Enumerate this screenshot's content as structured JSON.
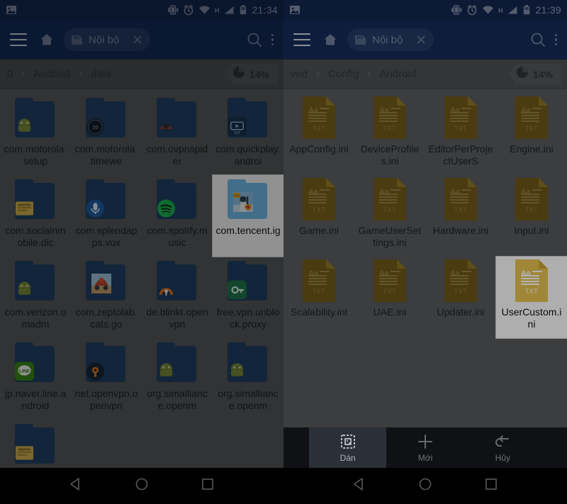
{
  "panes": [
    {
      "id": "left",
      "statusbar": {
        "icons": [
          "image-icon",
          "vibrate-icon",
          "alarm-icon",
          "wifi-icon",
          "signal-icon",
          "battery-icon"
        ],
        "network_type": "H",
        "time": "21:34"
      },
      "toolbar": {
        "menu_icon": "hamburger-icon",
        "home_icon": "home-icon",
        "tab_icon": "sdcard-icon",
        "tab_label": "Nội bộ",
        "tab_close_icon": "close-icon",
        "search_icon": "search-icon",
        "overflow_icon": "overflow-menu-icon"
      },
      "breadcrumb": {
        "crumbs": [
          "0",
          "Android",
          "data"
        ],
        "separator": "›",
        "storage_icon": "pie-chart-icon",
        "storage_percent": "14%"
      },
      "items": [
        {
          "name": "com.motorola.setup",
          "type": "folder",
          "badge": "android-robot-icon",
          "selected": false
        },
        {
          "name": "com.motorola.timewe",
          "type": "folder",
          "badge": "watch-face-icon",
          "selected": false
        },
        {
          "name": "com.ovpnspider",
          "type": "folder",
          "badge": "ovpn-spider-icon",
          "selected": false
        },
        {
          "name": "com.quickplay.androi",
          "type": "folder",
          "badge": "video-player-icon",
          "selected": false
        },
        {
          "name": "com.socialnmobile.dic",
          "type": "folder",
          "badge": "notepad-icon",
          "selected": false
        },
        {
          "name": "com.splendapps.vox",
          "type": "folder",
          "badge": "microphone-icon",
          "selected": false
        },
        {
          "name": "com.spotify.music",
          "type": "folder",
          "badge": "spotify-icon",
          "selected": false
        },
        {
          "name": "com.tencent.ig",
          "type": "folder",
          "badge": "pubg-mobile-icon",
          "selected": true
        },
        {
          "name": "com.verizon.omadm",
          "type": "folder",
          "badge": "android-robot-icon",
          "selected": false
        },
        {
          "name": "com.zeptolab.cats.go",
          "type": "folder",
          "badge": "cats-game-icon",
          "selected": false
        },
        {
          "name": "de.blinkt.openvpn",
          "type": "folder",
          "badge": "openvpn-icon",
          "selected": false
        },
        {
          "name": "free.vpn.unblock.proxy",
          "type": "folder",
          "badge": "vpn-key-icon",
          "selected": false
        },
        {
          "name": "jp.naver.line.android",
          "type": "folder",
          "badge": "line-icon",
          "selected": false
        },
        {
          "name": "net.openvpn.openvpn",
          "type": "folder",
          "badge": "openvpn-connect-icon",
          "selected": false
        },
        {
          "name": "org.simalliance.openm",
          "type": "folder",
          "badge": "android-robot-icon",
          "selected": false
        },
        {
          "name": "org.simalliance.openm",
          "type": "folder",
          "badge": "android-robot-icon",
          "selected": false
        },
        {
          "name": "",
          "type": "folder",
          "badge": "notepad-icon",
          "selected": false
        }
      ],
      "actionbar": null
    },
    {
      "id": "right",
      "statusbar": {
        "icons": [
          "image-icon",
          "vibrate-icon",
          "alarm-icon",
          "wifi-icon",
          "signal-icon",
          "battery-icon"
        ],
        "network_type": "H",
        "time": "21:39"
      },
      "toolbar": {
        "menu_icon": "hamburger-icon",
        "home_icon": "home-icon",
        "tab_icon": "sdcard-icon",
        "tab_label": "Nội bộ",
        "tab_close_icon": "close-icon",
        "search_icon": "search-icon",
        "overflow_icon": "overflow-menu-icon"
      },
      "breadcrumb": {
        "crumbs": [
          "ved",
          "Config",
          "Android"
        ],
        "separator": "›",
        "storage_icon": "pie-chart-icon",
        "storage_percent": "14%"
      },
      "items": [
        {
          "name": "AppConfig.ini",
          "type": "txt",
          "badge": "txt-file-icon",
          "selected": false
        },
        {
          "name": "DeviceProfiles.ini",
          "type": "txt",
          "badge": "txt-file-icon",
          "selected": false
        },
        {
          "name": "EditorPerProjectUserS",
          "type": "txt",
          "badge": "txt-file-icon",
          "selected": false
        },
        {
          "name": "Engine.ini",
          "type": "txt",
          "badge": "txt-file-icon",
          "selected": false
        },
        {
          "name": "Game.ini",
          "type": "txt",
          "badge": "txt-file-icon",
          "selected": false
        },
        {
          "name": "GameUserSettings.ini",
          "type": "txt",
          "badge": "txt-file-icon",
          "selected": false
        },
        {
          "name": "Hardware.ini",
          "type": "txt",
          "badge": "txt-file-icon",
          "selected": false
        },
        {
          "name": "Input.ini",
          "type": "txt",
          "badge": "txt-file-icon",
          "selected": false
        },
        {
          "name": "Scalability.ini",
          "type": "txt",
          "badge": "txt-file-icon",
          "selected": false
        },
        {
          "name": "UAE.ini",
          "type": "txt",
          "badge": "txt-file-icon",
          "selected": false
        },
        {
          "name": "Updater.ini",
          "type": "txt",
          "badge": "txt-file-icon",
          "selected": false
        },
        {
          "name": "UserCustom.ini",
          "type": "txt",
          "badge": "txt-file-icon",
          "selected": true
        }
      ],
      "actionbar": {
        "buttons": [
          {
            "label": "Dán",
            "icon": "paste-icon",
            "active": true
          },
          {
            "label": "Mới",
            "icon": "plus-icon",
            "active": false
          },
          {
            "label": "Hủy",
            "icon": "undo-icon",
            "active": false
          }
        ]
      }
    }
  ],
  "navbar": {
    "buttons": [
      "back-icon",
      "home-icon",
      "recents-icon"
    ]
  },
  "doc_icon": {
    "aa": "Aa",
    "ext": "TXT"
  },
  "colors": {
    "status_bar": "#12264c",
    "toolbar": "#132a55",
    "breadcrumb": "#4a4d4f",
    "content_bg": "#55585a",
    "folder": "#1f4064",
    "folder_selected": "#72bdec",
    "doc": "#6b5517",
    "doc_selected": "#e6c24f",
    "action_bar": "#101114",
    "selection_card": "#fafafa"
  }
}
